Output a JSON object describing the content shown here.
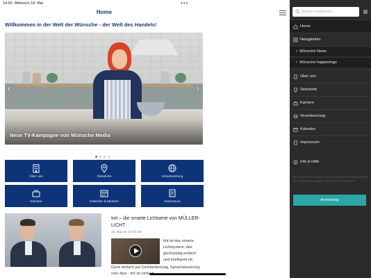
{
  "status_bar": {
    "time": "14:55",
    "date": "Mittwoch 18. Mai",
    "dots": "•••",
    "right_text": ""
  },
  "header": {
    "title": "Home"
  },
  "welcome": "Willkommen in der Welt der Wünsche - der Welt des Handels!",
  "hero": {
    "caption": "Neue TV-Kampagne von Wünsche Media",
    "prev_glyph": "‹",
    "next_glyph": "›",
    "pages": 4,
    "active_page": 1
  },
  "tiles": [
    {
      "label": "Über uns",
      "icon": "building-icon"
    },
    {
      "label": "Standorte",
      "icon": "location-pin-icon"
    },
    {
      "label": "Verantwortung",
      "icon": "globe-icon"
    },
    {
      "label": "Karriere",
      "icon": "briefcase-icon"
    },
    {
      "label": "Kalender & Messen",
      "icon": "calendar-icon"
    },
    {
      "label": "Impressum",
      "icon": "document-icon"
    }
  ],
  "news": {
    "title": "tint – die smarte Lichtserie von MÜLLER-LICHT",
    "date": "16. Mai um 17:36 Uhr",
    "text": "tint ist das smarte Lichtsystem, das gleichzeitig einfach und intelligent ist:",
    "text2": "Ganz einfach per Fernbedienung, Sprachsteuerung oder App - tint ist einfach..."
  },
  "sidebar": {
    "search_placeholder": "Suchen in Wünsche",
    "items": [
      {
        "label": "Home",
        "icon": "home-icon"
      },
      {
        "label": "Neuigkeiten",
        "icon": "news-icon"
      },
      {
        "label": "Wünsche News",
        "sub": true
      },
      {
        "label": "Wünsche happenings",
        "sub": true
      },
      {
        "label": "Über uns",
        "icon": "building-icon"
      },
      {
        "label": "Standorte",
        "icon": "location-pin-icon"
      },
      {
        "label": "Karriere",
        "icon": "briefcase-icon"
      },
      {
        "label": "Verantwortung",
        "icon": "globe-icon"
      },
      {
        "label": "Kalender",
        "icon": "calendar-icon"
      },
      {
        "label": "Impressum",
        "icon": "document-icon"
      },
      {
        "label": "Info & Hilfe",
        "icon": "info-icon"
      }
    ],
    "info_text": "Berechtigte Wünsche Gruppe Mitarbeiter erhalten nach der Anmeldung Zugriff auf weitere Funktionen.",
    "signup_label": "Anmeldung"
  },
  "colors": {
    "tile_blue": "#0d3478",
    "heading_blue": "#1d3a6b",
    "sidebar_bg": "#2b2b2b",
    "accent_teal": "#2aa6a6"
  }
}
